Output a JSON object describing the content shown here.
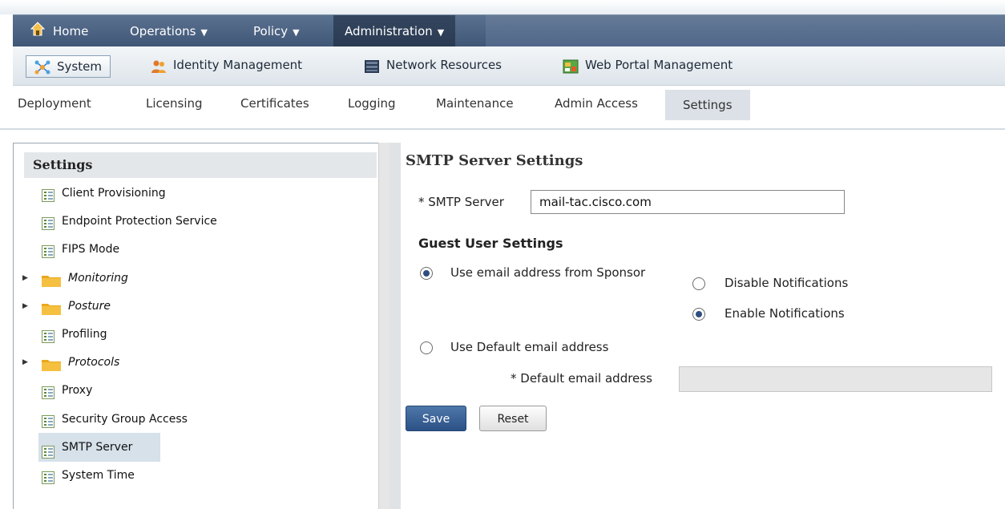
{
  "nav": {
    "home": "Home",
    "operations": "Operations",
    "policy": "Policy",
    "administration": "Administration"
  },
  "subnav": {
    "system": "System",
    "identity": "Identity Management",
    "network": "Network Resources",
    "webportal": "Web Portal Management"
  },
  "tabs": [
    "Deployment",
    "Licensing",
    "Certificates",
    "Logging",
    "Maintenance",
    "Admin Access",
    "Settings"
  ],
  "left": {
    "header": "Settings",
    "items": [
      {
        "label": "Client Provisioning",
        "type": "leaf"
      },
      {
        "label": "Endpoint Protection Service",
        "type": "leaf"
      },
      {
        "label": "FIPS Mode",
        "type": "leaf"
      },
      {
        "label": "Monitoring",
        "type": "folder"
      },
      {
        "label": "Posture",
        "type": "folder"
      },
      {
        "label": "Profiling",
        "type": "leaf"
      },
      {
        "label": "Protocols",
        "type": "folder"
      },
      {
        "label": "Proxy",
        "type": "leaf"
      },
      {
        "label": "Security Group Access",
        "type": "leaf"
      },
      {
        "label": "SMTP Server",
        "type": "leaf",
        "selected": true
      },
      {
        "label": "System Time",
        "type": "leaf"
      }
    ]
  },
  "main": {
    "title": "SMTP Server Settings",
    "smtp_label": "* SMTP Server",
    "smtp_value": "mail-tac.cisco.com",
    "guest_title": "Guest User Settings",
    "opt_sponsor": "Use email address from Sponsor",
    "opt_disable": "Disable Notifications",
    "opt_enable": "Enable Notifications",
    "opt_default": "Use Default email address",
    "default_label": "* Default email address",
    "default_value": "",
    "save": "Save",
    "reset": "Reset"
  },
  "colors": {
    "nav_bg": "#4b6183",
    "save_bg": "#2f5a8f",
    "selected_row": "#d6e1ea"
  }
}
